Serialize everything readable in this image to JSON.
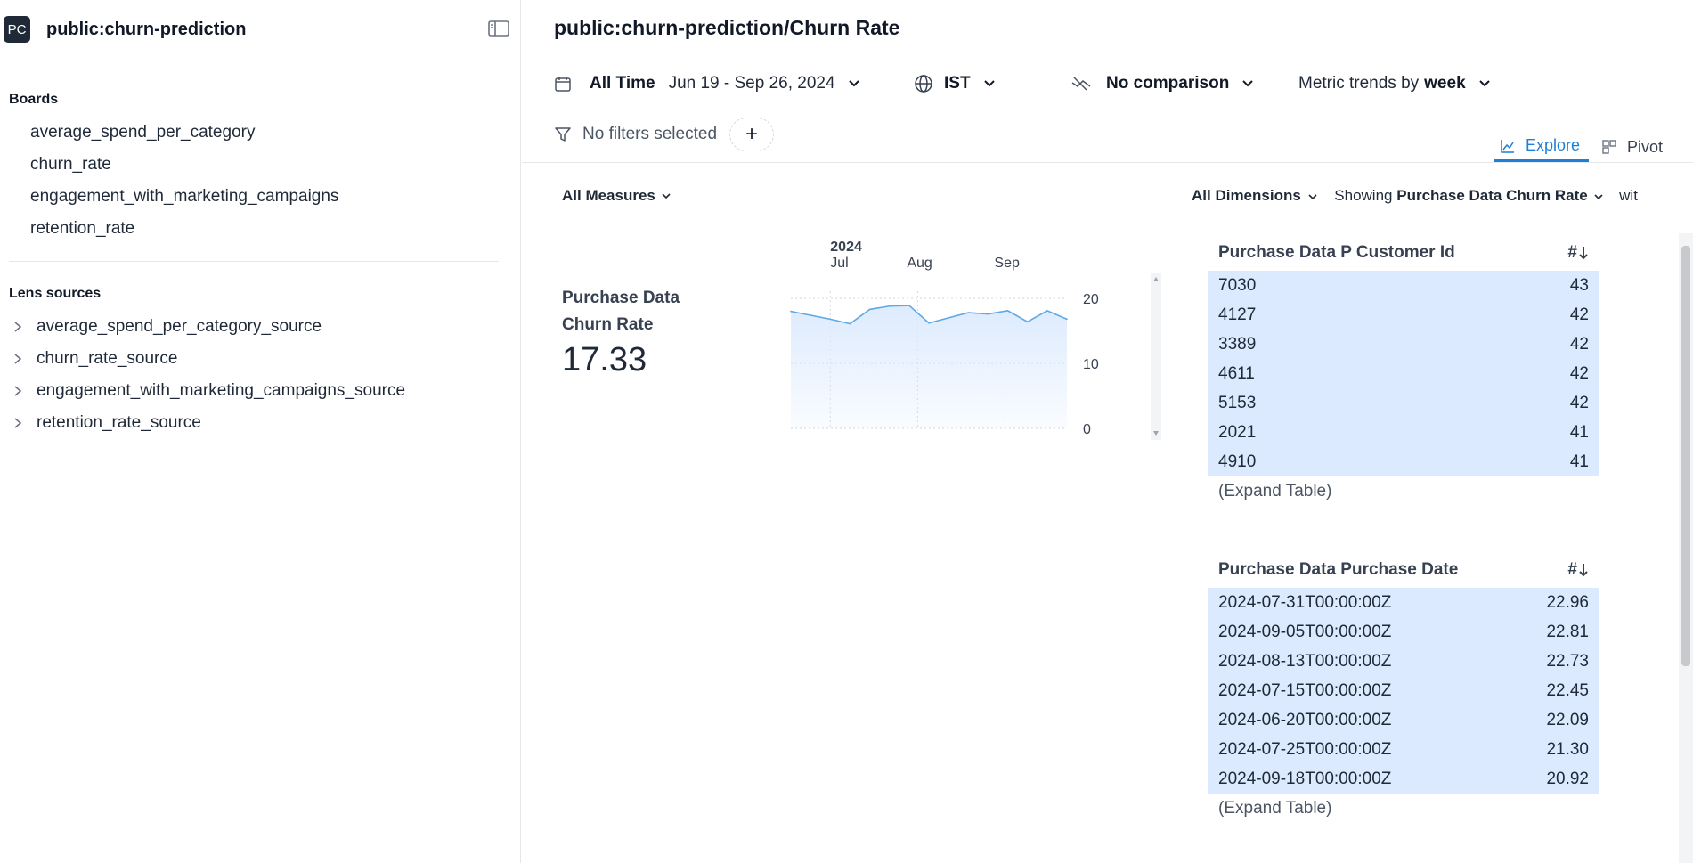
{
  "sidebar": {
    "project_badge": "PC",
    "project_name": "public:churn-prediction",
    "boards_title": "Boards",
    "boards": [
      {
        "label": "average_spend_per_category"
      },
      {
        "label": "churn_rate"
      },
      {
        "label": "engagement_with_marketing_campaigns"
      },
      {
        "label": "retention_rate"
      }
    ],
    "sources_title": "Lens sources",
    "sources": [
      {
        "label": "average_spend_per_category_source"
      },
      {
        "label": "churn_rate_source"
      },
      {
        "label": "engagement_with_marketing_campaigns_source"
      },
      {
        "label": "retention_rate_source"
      }
    ]
  },
  "header": {
    "title": "public:churn-prediction/Churn Rate"
  },
  "toolbar": {
    "time_preset": "All Time",
    "date_range": "Jun 19 - Sep 26, 2024",
    "timezone": "IST",
    "comparison": "No comparison",
    "trend_prefix": "Metric trends by",
    "trend_grain": "week"
  },
  "filters": {
    "empty_text": "No filters selected",
    "add_label": "+"
  },
  "tabs": {
    "explore": "Explore",
    "pivot": "Pivot",
    "active": "explore"
  },
  "measures": {
    "selector_label": "All Measures"
  },
  "dimensions": {
    "selector_label": "All Dimensions",
    "showing_prefix": "Showing",
    "showing_measure": "Purchase Data Churn Rate",
    "suffix": "wit"
  },
  "measure_card": {
    "name": "Purchase Data Churn Rate",
    "value": "17.33"
  },
  "chart_data": {
    "type": "area",
    "year_label": "2024",
    "month_labels": [
      "Jul",
      "Aug",
      "Sep"
    ],
    "x": [
      "2024-06-17",
      "2024-06-24",
      "2024-07-01",
      "2024-07-08",
      "2024-07-15",
      "2024-07-22",
      "2024-07-29",
      "2024-08-05",
      "2024-08-12",
      "2024-08-19",
      "2024-08-26",
      "2024-09-02",
      "2024-09-09",
      "2024-09-16",
      "2024-09-23"
    ],
    "values": [
      18.0,
      17.4,
      16.8,
      16.1,
      18.3,
      18.8,
      18.9,
      16.2,
      17.0,
      17.8,
      17.6,
      18.1,
      16.4,
      18.1,
      16.8
    ],
    "yticks": [
      "0",
      "10",
      "20"
    ],
    "ylim": [
      0,
      20
    ],
    "grid": true,
    "color": "#5fa8e6",
    "fill": "#dbeafe"
  },
  "tables": [
    {
      "header": "Purchase Data P Customer Id",
      "sort_label": "#",
      "rows": [
        {
          "key": "7030",
          "value": "43"
        },
        {
          "key": "4127",
          "value": "42"
        },
        {
          "key": "3389",
          "value": "42"
        },
        {
          "key": "4611",
          "value": "42"
        },
        {
          "key": "5153",
          "value": "42"
        },
        {
          "key": "2021",
          "value": "41"
        },
        {
          "key": "4910",
          "value": "41"
        }
      ],
      "expand": "(Expand Table)"
    },
    {
      "header": "Purchase Data Purchase Date",
      "sort_label": "#",
      "rows": [
        {
          "key": "2024-07-31T00:00:00Z",
          "value": "22.96"
        },
        {
          "key": "2024-09-05T00:00:00Z",
          "value": "22.81"
        },
        {
          "key": "2024-08-13T00:00:00Z",
          "value": "22.73"
        },
        {
          "key": "2024-07-15T00:00:00Z",
          "value": "22.45"
        },
        {
          "key": "2024-06-20T00:00:00Z",
          "value": "22.09"
        },
        {
          "key": "2024-07-25T00:00:00Z",
          "value": "21.30"
        },
        {
          "key": "2024-09-18T00:00:00Z",
          "value": "20.92"
        }
      ],
      "expand": "(Expand Table)"
    }
  ]
}
